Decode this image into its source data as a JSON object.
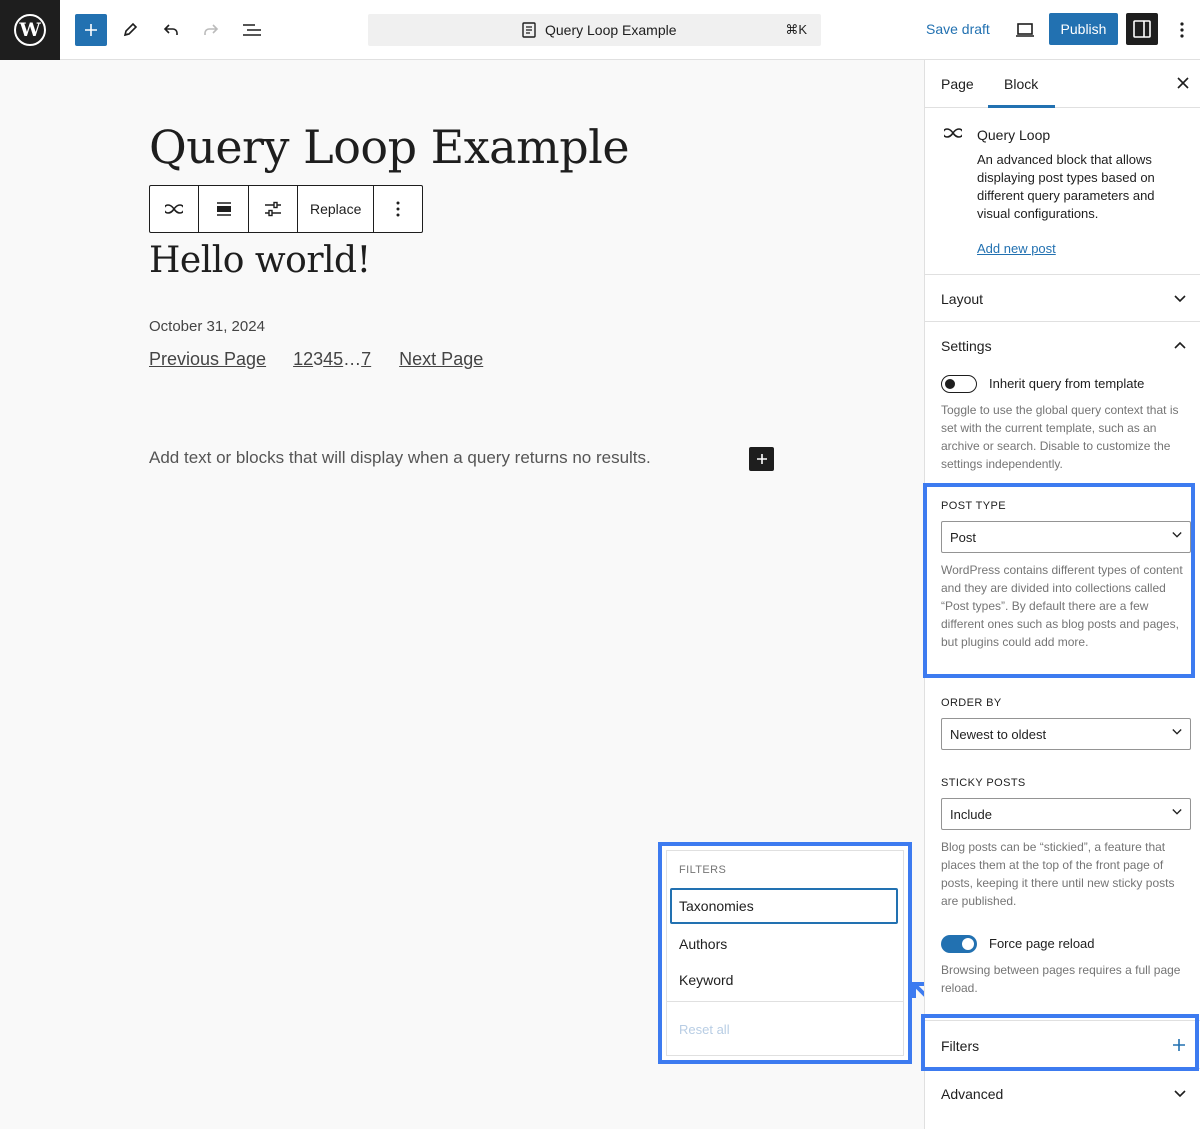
{
  "topbar": {
    "document_title": "Query Loop Example",
    "shortcut": "⌘K",
    "save_draft": "Save draft",
    "publish": "Publish"
  },
  "canvas": {
    "page_title": "Query Loop Example",
    "toolbar": {
      "replace": "Replace"
    },
    "post_title": "Hello world!",
    "post_date": "October 31, 2024",
    "pagination": {
      "previous": "Previous Page",
      "pages": [
        "1",
        "2",
        "3",
        "4",
        "5",
        "…",
        "7"
      ],
      "current_page": "3",
      "next": "Next Page"
    },
    "no_results": "Add text or blocks that will display when a query returns no results."
  },
  "filters_popover": {
    "heading": "FILTERS",
    "items": [
      "Taxonomies",
      "Authors",
      "Keyword"
    ],
    "reset": "Reset all"
  },
  "sidebar": {
    "tabs": [
      "Page",
      "Block"
    ],
    "active_tab": "Block",
    "block": {
      "title": "Query Loop",
      "description": "An advanced block that allows displaying post types based on different query parameters and visual configurations.",
      "add_new_post": "Add new post"
    },
    "panels": {
      "layout": "Layout",
      "settings": "Settings",
      "filters": "Filters",
      "advanced": "Advanced"
    },
    "settings": {
      "inherit_label": "Inherit query from template",
      "inherit_on": false,
      "inherit_help": "Toggle to use the global query context that is set with the current template, such as an archive or search. Disable to customize the settings independently.",
      "post_type_label": "POST TYPE",
      "post_type_value": "Post",
      "post_type_help": "WordPress contains different types of content and they are divided into collections called “Post types”. By default there are a few different ones such as blog posts and pages, but plugins could add more.",
      "order_by_label": "ORDER BY",
      "order_by_value": "Newest to oldest",
      "sticky_label": "STICKY POSTS",
      "sticky_value": "Include",
      "sticky_help": "Blog posts can be “stickied”, a feature that places them at the top of the front page of posts, keeping it there until new sticky posts are published.",
      "reload_label": "Force page reload",
      "reload_on": true,
      "reload_help": "Browsing between pages requires a full page reload."
    }
  },
  "colors": {
    "accent": "#2271b1",
    "highlight": "#3d7bf0",
    "dark": "#1e1e1e"
  }
}
